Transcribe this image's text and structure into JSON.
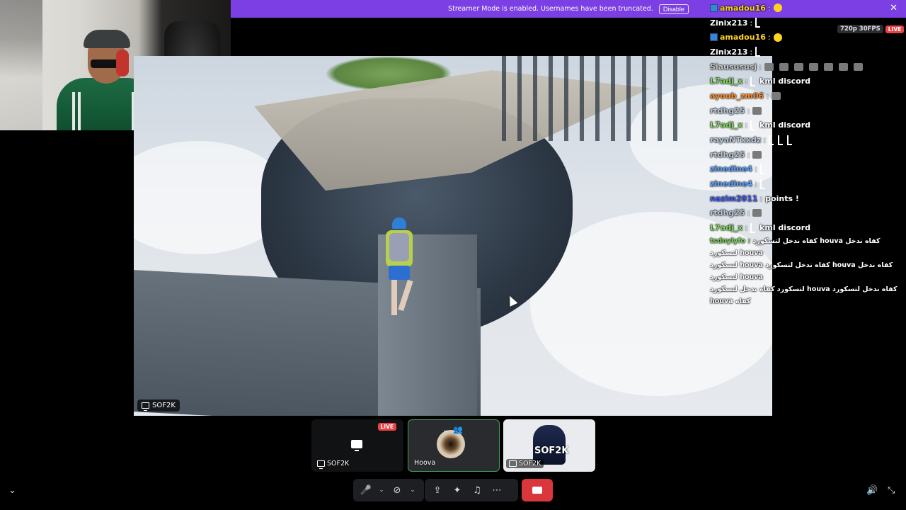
{
  "banner": {
    "text": "Streamer Mode is enabled. Usernames have been truncated.",
    "disable_label": "Disable",
    "close_glyph": "✕"
  },
  "stream": {
    "quality": "720p 30FPS",
    "live": "LIVE",
    "presenter_label": "SOF2K"
  },
  "chat": [
    {
      "user": "amadou16",
      "color": "#ffd21f",
      "badge": true,
      "msg": "",
      "emote": "emoji"
    },
    {
      "user": "Zinix213",
      "color": "#ffffff",
      "badge": false,
      "msg": "",
      "emote": "L"
    },
    {
      "user": "amadou16",
      "color": "#ffd21f",
      "badge": true,
      "msg": "",
      "emote": "emoji"
    },
    {
      "user": "Zinix213",
      "color": "#ffffff",
      "badge": false,
      "msg": "",
      "emote": "L"
    },
    {
      "user": "Siausususj",
      "color": "#c8c8c8",
      "badge": false,
      "msg": "",
      "emote": "gray-row"
    },
    {
      "user": "L7adj_x",
      "color": "#7ed957",
      "badge": false,
      "msg": "kml discord",
      "emote": "L"
    },
    {
      "user": "ayoub_zm06",
      "color": "#ff8c2a",
      "badge": false,
      "msg": "",
      "emote": "gray"
    },
    {
      "user": "rtdhg25",
      "color": "#b8c7d9",
      "badge": false,
      "msg": "",
      "emote": "gray"
    },
    {
      "user": "L7adj_x",
      "color": "#7ed957",
      "badge": false,
      "msg": "kml discord",
      "emote": "L"
    },
    {
      "user": "rayaNTxxdz",
      "color": "#b8c7d9",
      "badge": false,
      "msg": "",
      "emote": "LLL"
    },
    {
      "user": "rtdhg25",
      "color": "#b8c7d9",
      "badge": false,
      "msg": "",
      "emote": "gray"
    },
    {
      "user": "zinedine4",
      "color": "#5aa0ff",
      "badge": false,
      "msg": "",
      "emote": "L"
    },
    {
      "user": "zinedine4",
      "color": "#5aa0ff",
      "badge": false,
      "msg": "",
      "emote": "L"
    },
    {
      "user": "nazim2011",
      "color": "#3b5bff",
      "badge": false,
      "msg": "points !",
      "emote": ""
    },
    {
      "user": "rtdhg25",
      "color": "#b8c7d9",
      "badge": false,
      "msg": "",
      "emote": "gray"
    },
    {
      "user": "L7adj_x",
      "color": "#7ed957",
      "badge": false,
      "msg": "kml discord",
      "emote": "L"
    }
  ],
  "chat_rtl": {
    "user": "tsdnylyfo",
    "user_color": "#7ed957",
    "lines": [
      "كفاه ندخل لتسكورد houva  كفاه ندخل لتسكورد houva",
      "لتسكورد houva  كفاه ندخل لتسكورد houva كفاه ندخل لتسكورد houva",
      "لتسكورد  كفاه ندخل لتسكورد houva كفاه ندخل لتسكورد houva كفاه"
    ]
  },
  "tiles": {
    "screen": {
      "label": "SOF2K",
      "live": "LIVE"
    },
    "hoova": {
      "label": "Hoova"
    },
    "sof": {
      "label": "SOF2K",
      "logo": "SOF2K"
    }
  },
  "toolbar": {
    "mic_icon": "🎤",
    "camera_off_icon": "⊘",
    "screen_share_icon": "⇪",
    "activities_icon": "✦",
    "soundboard_icon": "♫",
    "more_icon": "⋯",
    "caret": "⌄"
  },
  "corners": {
    "collapse": "⌄",
    "volume": "🔊",
    "exit_fullscreen": "⤡"
  },
  "colors": {
    "banner": "#7b3fe4",
    "live": "#ed4245",
    "end_call": "#da373c",
    "speaking": "#3ba55d"
  }
}
